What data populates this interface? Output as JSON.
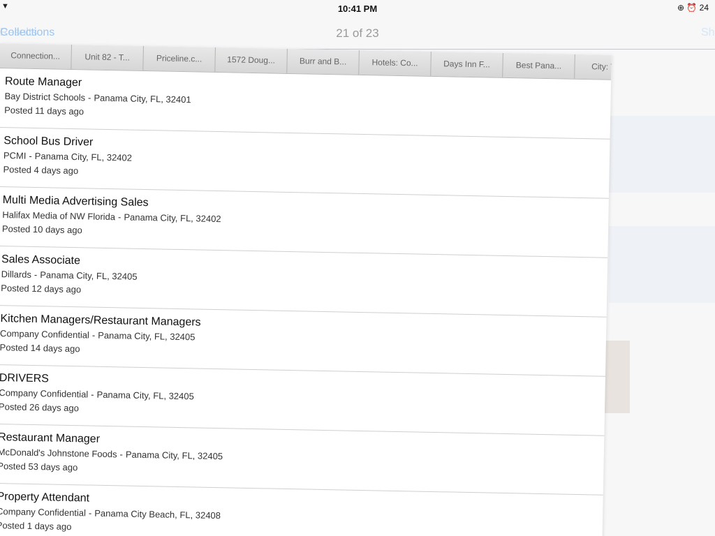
{
  "status": {
    "wifi_icon": "wifi-icon",
    "time": "10:41 PM",
    "right_text": "⊕ ⏰ 24"
  },
  "nav": {
    "back_label_a": "Collections",
    "back_label_b": "Results",
    "counter": "21 of 23",
    "right_label": "Share"
  },
  "tabs": [
    "Connection...",
    "Unit 82 - T...",
    "Priceline.c...",
    "1572 Doug...",
    "Burr and B...",
    "Hotels: Co...",
    "Days Inn F...",
    "Best Pana...",
    "City: Tra..."
  ],
  "jobs": [
    {
      "title": "Route Manager",
      "company": "Bay District Schools",
      "location": "Panama City, FL, 32401",
      "posted": "Posted 11 days ago"
    },
    {
      "title": "School Bus Driver",
      "company": "PCMI",
      "location": "Panama City, FL, 32402",
      "posted": "Posted 4 days ago"
    },
    {
      "title": "Multi Media Advertising Sales",
      "company": "Halifax Media of NW Florida",
      "location": "Panama City, FL, 32402",
      "posted": "Posted 10 days ago"
    },
    {
      "title": "Sales Associate",
      "company": "Dillards",
      "location": "Panama City, FL, 32405",
      "posted": "Posted 12 days ago"
    },
    {
      "title": "Kitchen Managers/Restaurant Managers",
      "company": "Company Confidential",
      "location": "Panama City, FL, 32405",
      "posted": "Posted 14 days ago"
    },
    {
      "title": "DRIVERS",
      "company": "Company Confidential",
      "location": "Panama City, FL, 32405",
      "posted": "Posted 26 days ago"
    },
    {
      "title": "Restaurant Manager",
      "company": "McDonald's Johnstone Foods",
      "location": "Panama City, FL, 32405",
      "posted": "Posted 53 days ago"
    },
    {
      "title": "Property Attendant",
      "company": "Company Confidential",
      "location": "Panama City Beach, FL, 32408",
      "posted": "Posted 1 days ago"
    }
  ],
  "separator": "-"
}
